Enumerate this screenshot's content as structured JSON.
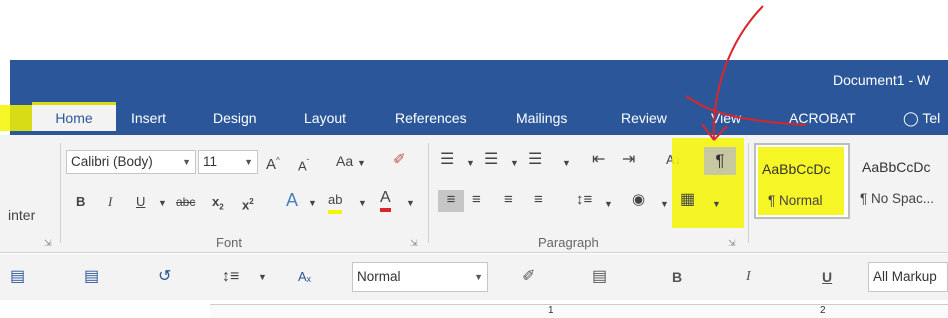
{
  "window": {
    "title": "Document1 - W"
  },
  "tabs": [
    "Home",
    "Insert",
    "Design",
    "Layout",
    "References",
    "Mailings",
    "Review",
    "View",
    "ACROBAT"
  ],
  "tell_me": "Tel",
  "clipboard": {
    "partial_label": "inter"
  },
  "font": {
    "family": "Calibri (Body)",
    "size": "11",
    "group_label": "Font",
    "grow": "A",
    "shrink": "A",
    "change_case": "Aa",
    "bold": "B",
    "italic": "I",
    "underline": "U",
    "strike": "abc",
    "sub": "x",
    "sub_mark": "2",
    "sup": "x",
    "sup_mark": "2",
    "effects": "A",
    "highlight": "ab",
    "color": "A"
  },
  "paragraph": {
    "group_label": "Paragraph",
    "show_marks": "¶",
    "sort": "A↓"
  },
  "styles": [
    {
      "sample": "AaBbCcDc",
      "name": "¶ Normal"
    },
    {
      "sample": "AaBbCcDc",
      "name": "¶ No Spac..."
    }
  ],
  "quick_toolbar": {
    "style_value": "Normal",
    "bold": "B",
    "italic": "I",
    "underline": "U",
    "markup": "All Markup"
  },
  "colors": {
    "brand": "#2b579a",
    "highlight": "#f5f500",
    "annotation": "#d9262c",
    "ribbon": "#f3f3f3"
  },
  "ruler": {
    "marks": [
      "1",
      "2"
    ]
  }
}
